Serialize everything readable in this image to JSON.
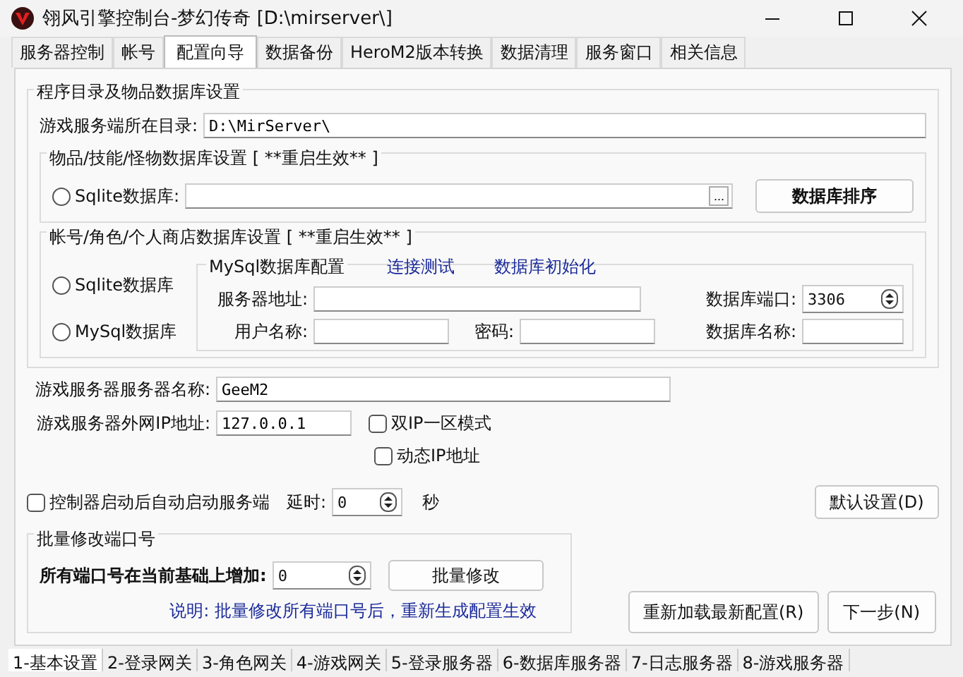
{
  "window": {
    "title": "翎风引擎控制台-梦幻传奇 [D:\\mirserver\\]"
  },
  "tabs": [
    {
      "label": "服务器控制",
      "selected": false
    },
    {
      "label": "帐号",
      "selected": false
    },
    {
      "label": "配置向导",
      "selected": true
    },
    {
      "label": "数据备份",
      "selected": false
    },
    {
      "label": "HeroM2版本转换",
      "selected": false
    },
    {
      "label": "数据清理",
      "selected": false
    },
    {
      "label": "服务窗口",
      "selected": false
    },
    {
      "label": "相关信息",
      "selected": false
    }
  ],
  "program_group": {
    "title": "程序目录及物品数据库设置",
    "dir_label": "游戏服务端所在目录:",
    "dir_value": "D:\\MirServer\\",
    "item_db": {
      "title": "物品/技能/怪物数据库设置 [ **重启生效** ]",
      "radio": {
        "label": "Sqlite数据库:",
        "checked": false
      },
      "browse": "...",
      "sort_button": "数据库排序"
    },
    "account_db": {
      "title": "帐号/角色/个人商店数据库设置  [ **重启生效** ]",
      "radios": [
        {
          "label": "Sqlite数据库",
          "checked": false
        },
        {
          "label": "MySql数据库",
          "checked": false
        }
      ],
      "mysql": {
        "title": "MySql数据库配置",
        "links": [
          "连接测试",
          "数据库初始化"
        ],
        "server_label": "服务器地址:",
        "port_label": "数据库端口:",
        "port_value": "3306",
        "user_label": "用户名称:",
        "password_label": "密码:",
        "dbname_label": "数据库名称:"
      }
    }
  },
  "server_name": {
    "label": "游戏服务器服务器名称:",
    "value": "GeeM2"
  },
  "server_ip": {
    "label": "游戏服务器外网IP地址:",
    "value": "127.0.0.1"
  },
  "ip_options": [
    {
      "label": "双IP一区模式",
      "checked": false
    },
    {
      "label": "动态IP地址",
      "checked": false
    }
  ],
  "autostart": {
    "label": "控制器启动后自动启动服务端",
    "checked": false,
    "delay_label": "延时:",
    "delay_value": "0",
    "unit": "秒"
  },
  "default_button": "默认设置(D)",
  "batch_group": {
    "title": "批量修改端口号",
    "label": "所有端口号在当前基础上增加:",
    "value": "0",
    "button": "批量修改",
    "note": "说明: 批量修改所有端口号后，重新生成配置生效"
  },
  "reload_button": "重新加载最新配置(R)",
  "next_button": "下一步(N)",
  "bottom_tabs": [
    {
      "label": "1-基本设置",
      "selected": true
    },
    {
      "label": "2-登录网关",
      "selected": false
    },
    {
      "label": "3-角色网关",
      "selected": false
    },
    {
      "label": "4-游戏网关",
      "selected": false
    },
    {
      "label": "5-登录服务器",
      "selected": false
    },
    {
      "label": "6-数据库服务器",
      "selected": false
    },
    {
      "label": "7-日志服务器",
      "selected": false
    },
    {
      "label": "8-游戏服务器",
      "selected": false
    }
  ]
}
